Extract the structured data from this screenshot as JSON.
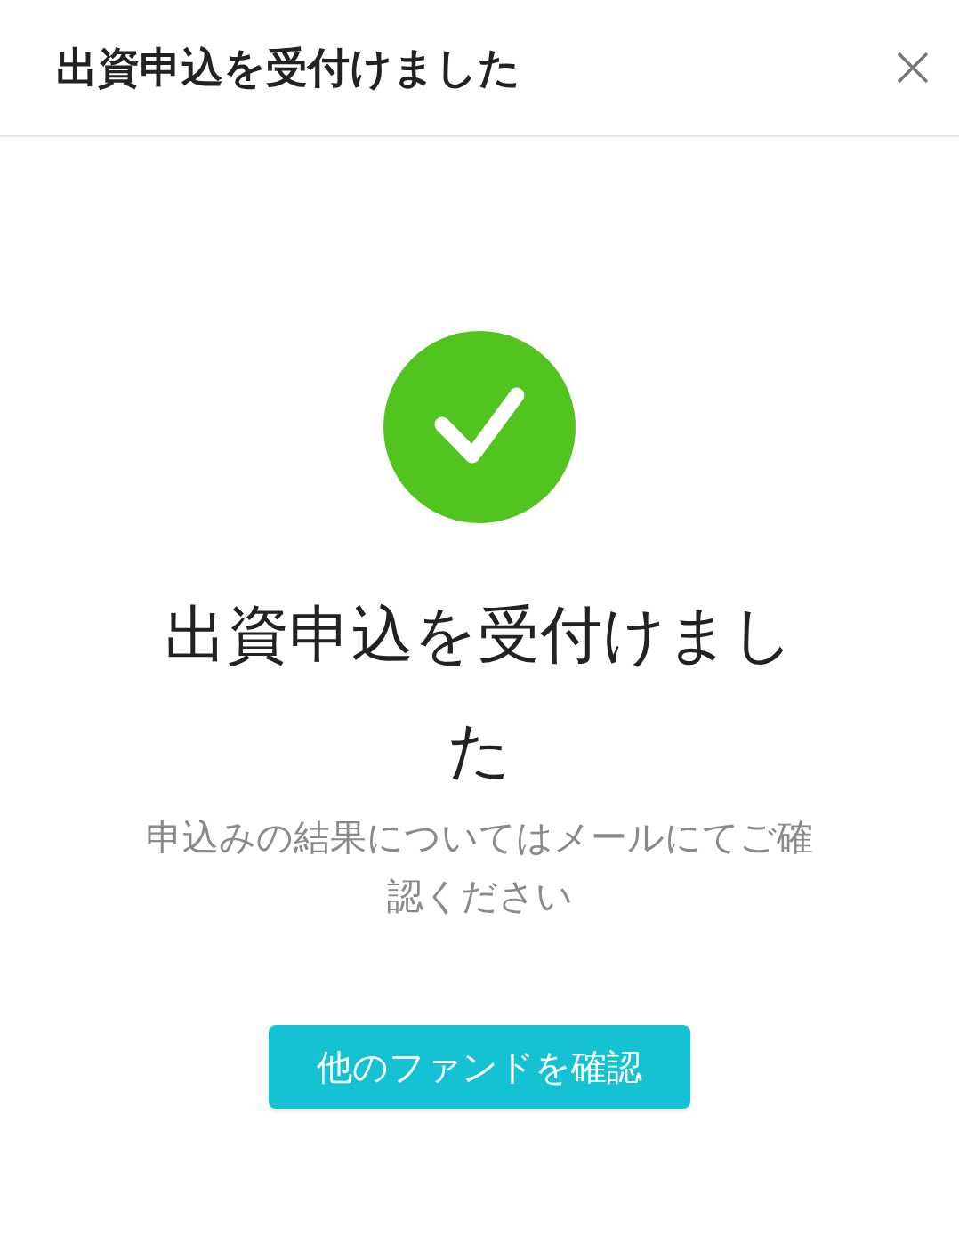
{
  "header": {
    "title": "出資申込を受付けました"
  },
  "result": {
    "heading": "出資申込を受付けました",
    "message": "申込みの結果についてはメールにてご確認ください"
  },
  "buttons": [
    {
      "label": "他のファンドを確認"
    }
  ]
}
